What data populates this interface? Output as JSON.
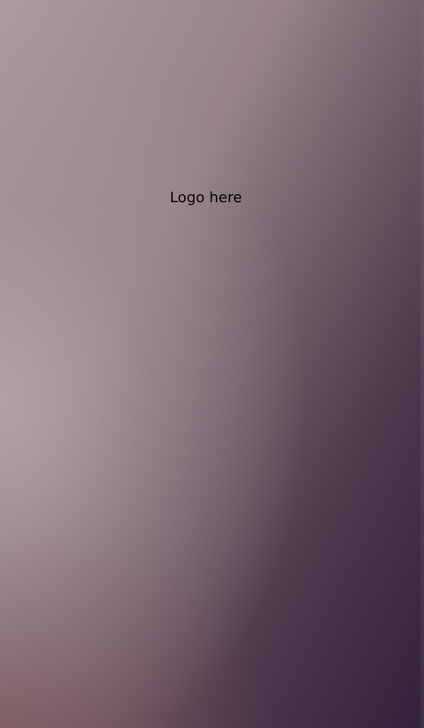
{
  "app": {
    "logo_placeholder": "Logo here"
  },
  "colors": {
    "top_left": "#a99ba0",
    "mid_left": "#b0a2a6",
    "bottom_left": "#7a5058",
    "bottom_right": "#33223a",
    "text": "#050305"
  }
}
